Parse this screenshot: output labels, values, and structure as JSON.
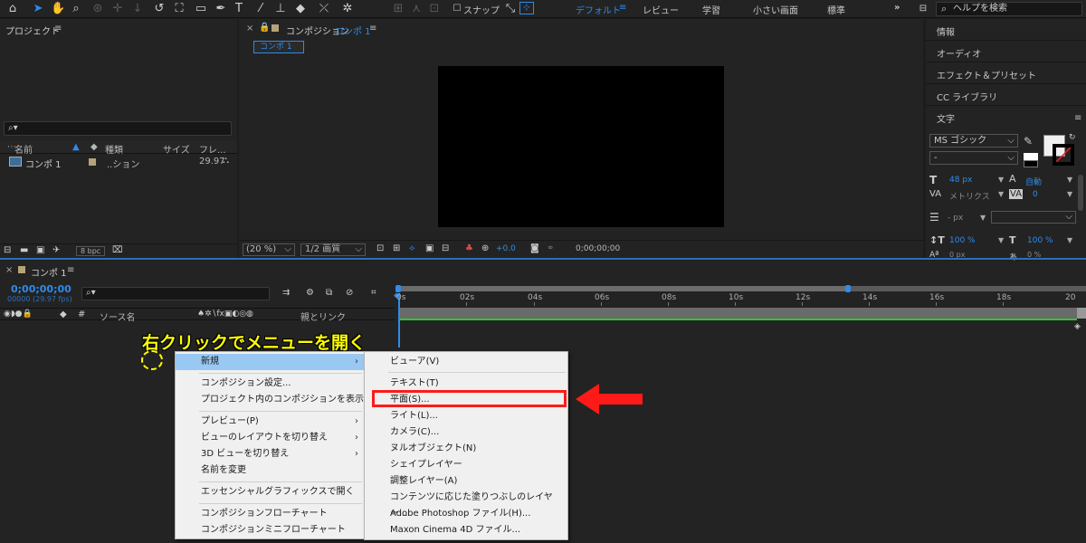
{
  "toolbar": {
    "snap_label": "スナップ",
    "workspaces": [
      "デフォルト",
      "レビュー",
      "学習",
      "小さい画面",
      "標準"
    ],
    "help_placeholder": "ヘルプを検索"
  },
  "project": {
    "title": "プロジェクト",
    "columns": [
      "名前",
      "種類",
      "サイズ",
      "フレ..."
    ],
    "item": {
      "name": "コンポ 1",
      "type": "..ション",
      "fps": "29.97"
    },
    "bpc": "8 bpc"
  },
  "composition": {
    "title_prefix": "コンポジション",
    "comp_name": "コンポ 1",
    "tab": "コンポ 1",
    "zoom": "(20 %)",
    "resolution": "1/2 画質",
    "exposure": "+0.0",
    "timecode": "0;00;00;00"
  },
  "right": {
    "items": [
      "情報",
      "オーディオ",
      "エフェクト＆プリセット",
      "CC ライブラリ",
      "文字"
    ],
    "font_name": "MS ゴシック",
    "font_style": "-",
    "size_value": "48 px",
    "leading_value": "自動",
    "kerning_label": "メトリクス",
    "tracking_value": "0",
    "px_label": "- px",
    "vscale": "100 %",
    "hscale": "100 %",
    "baseline": "0 px",
    "tsume": "0 %"
  },
  "timeline": {
    "tab": "コンポ 1",
    "timecode": "0;00;00;00",
    "frames": "00000 (29.97 fps)",
    "source_name_col": "ソース名",
    "parent_col": "親とリンク",
    "ticks": [
      "0s",
      "02s",
      "04s",
      "06s",
      "08s",
      "10s",
      "12s",
      "14s",
      "16s",
      "18s",
      "20"
    ]
  },
  "annotation": {
    "text": "右クリックでメニューを開く",
    "accent": "#ff1a1a",
    "yellow": "#ffff00"
  },
  "context_menu": {
    "items": [
      "新規",
      "コンポジション設定...",
      "プロジェクト内のコンポジションを表示",
      "プレビュー(P)",
      "ビューのレイアウトを切り替え",
      "3D ビューを切り替え",
      "名前を変更",
      "エッセンシャルグラフィックスで開く",
      "コンポジションフローチャート",
      "コンポジションミニフローチャート"
    ]
  },
  "submenu": {
    "items": [
      "ビューア(V)",
      "テキスト(T)",
      "平面(S)...",
      "ライト(L)...",
      "カメラ(C)...",
      "ヌルオブジェクト(N)",
      "シェイプレイヤー",
      "調整レイヤー(A)",
      "コンテンツに応じた塗りつぶしのレイヤー...",
      "Adobe Photoshop ファイル(H)...",
      "Maxon Cinema 4D ファイル..."
    ]
  }
}
